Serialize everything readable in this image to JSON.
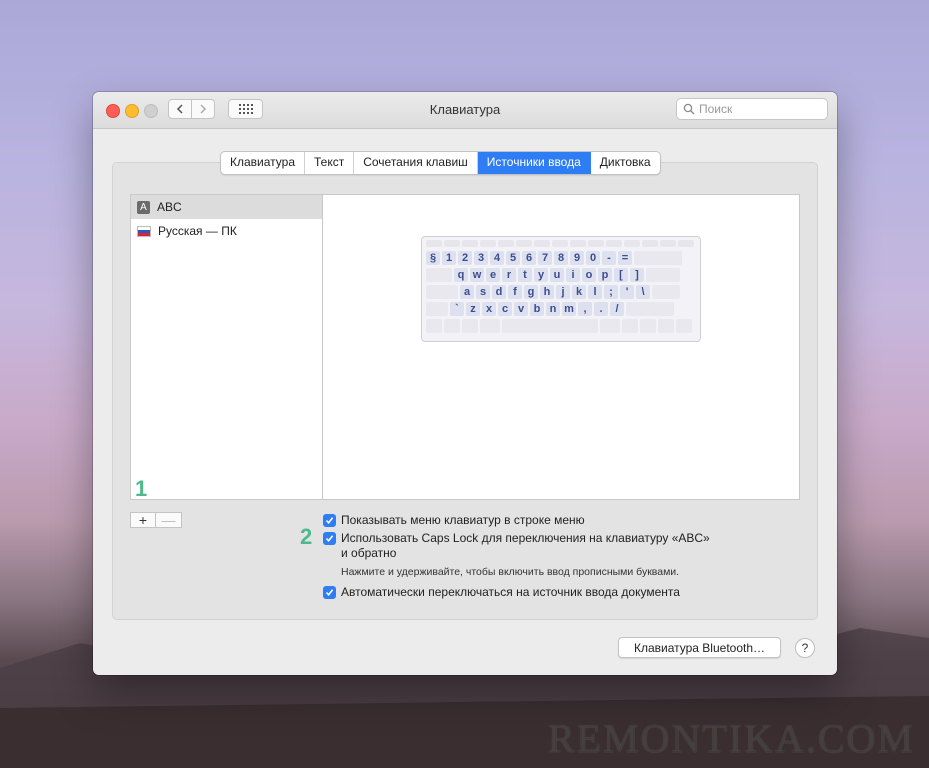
{
  "window": {
    "title": "Клавиатура",
    "search_placeholder": "Поиск"
  },
  "tabs": [
    {
      "label": "Клавиатура",
      "active": false
    },
    {
      "label": "Текст",
      "active": false
    },
    {
      "label": "Сочетания клавиш",
      "active": false
    },
    {
      "label": "Источники ввода",
      "active": true
    },
    {
      "label": "Диктовка",
      "active": false
    }
  ],
  "sources": [
    {
      "icon_char": "A",
      "label": "ABC",
      "selected": true
    },
    {
      "label": "Русская — ПК",
      "selected": false
    }
  ],
  "keyboard": {
    "row1": [
      "§",
      "1",
      "2",
      "3",
      "4",
      "5",
      "6",
      "7",
      "8",
      "9",
      "0",
      "-",
      "="
    ],
    "row2": [
      "q",
      "w",
      "e",
      "r",
      "t",
      "y",
      "u",
      "i",
      "o",
      "p",
      "[",
      "]"
    ],
    "row3": [
      "a",
      "s",
      "d",
      "f",
      "g",
      "h",
      "j",
      "k",
      "l",
      ";",
      "'",
      "\\"
    ],
    "row4": [
      "`",
      "z",
      "x",
      "c",
      "v",
      "b",
      "n",
      "m",
      ",",
      ".",
      "/"
    ]
  },
  "list_buttons": {
    "add": "+",
    "remove": "—"
  },
  "markers": {
    "first": "1",
    "second": "2"
  },
  "options": {
    "show_menu": "Показывать меню клавиатур в строке меню",
    "caps_lock_line1": "Использовать Caps Lock для переключения на клавиатуру «ABC»",
    "caps_lock_line2": "и обратно",
    "caps_lock_hint": "Нажмите и удерживайте, чтобы включить ввод прописными буквами.",
    "auto_switch": "Автоматически переключаться на источник ввода документа"
  },
  "buttons": {
    "bluetooth": "Клавиатура Bluetooth…",
    "help": "?"
  },
  "watermark": "REMONTIKA.COM",
  "colors": {
    "accent": "#2f7df5",
    "marker": "#4fb88c"
  }
}
